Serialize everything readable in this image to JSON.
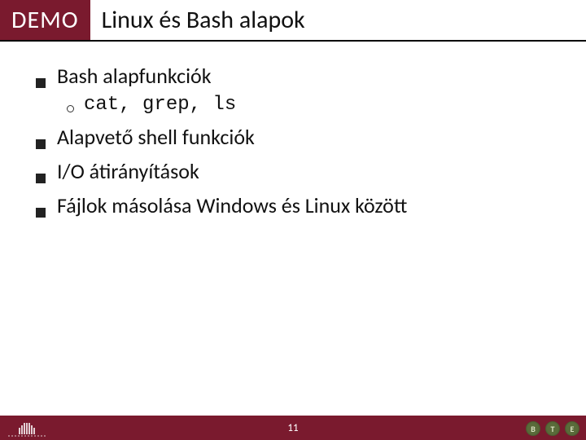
{
  "header": {
    "badge": "DEMO",
    "title": "Linux és Bash alapok"
  },
  "bullets": [
    {
      "text": "Bash alapfunkciók",
      "sub": [
        {
          "text": "cat, grep, ls"
        }
      ]
    },
    {
      "text": "Alapvető shell funkciók"
    },
    {
      "text": "I/O átirányítások"
    },
    {
      "text": "Fájlok másolása Windows és Linux között"
    }
  ],
  "footer": {
    "page": "11",
    "badges": [
      "B",
      "T",
      "E"
    ]
  }
}
